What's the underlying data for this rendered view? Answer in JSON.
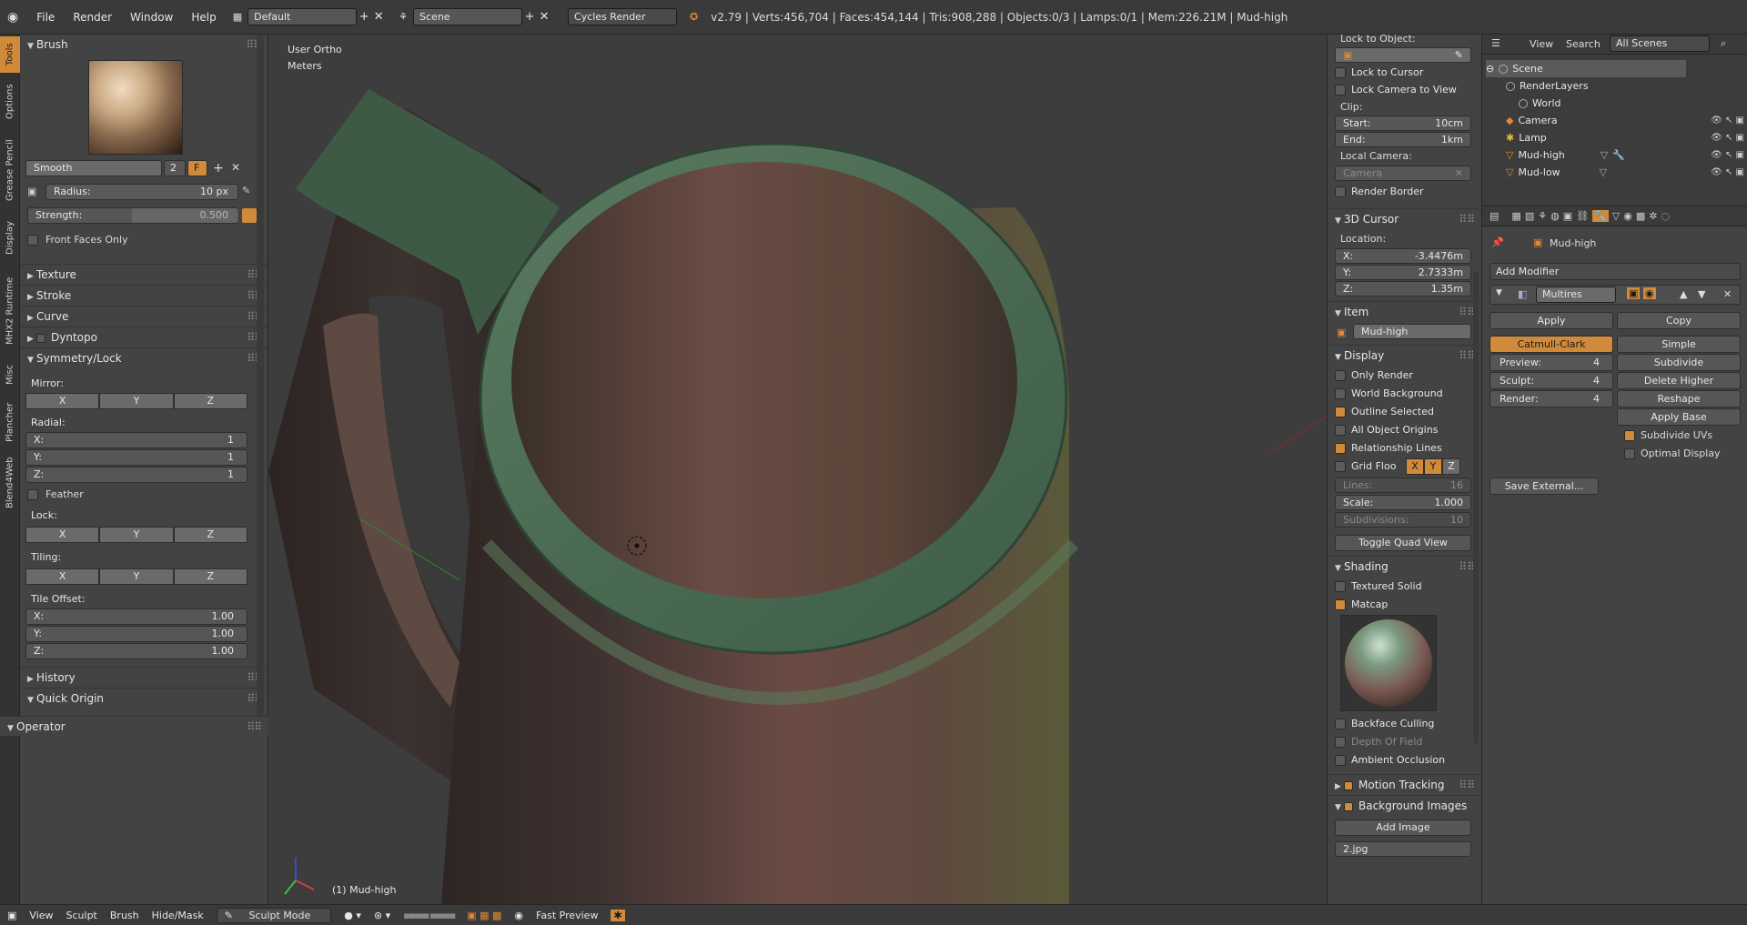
{
  "topbar": {
    "menus": [
      "File",
      "Render",
      "Window",
      "Help"
    ],
    "layout": "Default",
    "scene": "Scene",
    "engine": "Cycles Render",
    "status": "v2.79 | Verts:456,704 | Faces:454,144 | Tris:908,288 | Objects:0/3 | Lamps:0/1 | Mem:226.21M | Mud-high"
  },
  "tabs": [
    "Tools",
    "Options",
    "Grease Pencil",
    "Display",
    "MHX2 Runtime",
    "Misc",
    "Plancher",
    "Blend4Web"
  ],
  "toolshelf": {
    "brush_header": "Brush",
    "brush_name": "Smooth",
    "brush_users": "2",
    "brush_fake": "F",
    "radius_label": "Radius:",
    "radius_value": "10 px",
    "strength_label": "Strength:",
    "strength_value": "0.500",
    "front_faces": "Front Faces Only",
    "sections": [
      "Texture",
      "Stroke",
      "Curve",
      "Dyntopo"
    ],
    "symmetry_header": "Symmetry/Lock",
    "mirror": "Mirror:",
    "radial": "Radial:",
    "radial_x": "X:",
    "radial_x_val": "1",
    "radial_y": "Y:",
    "radial_y_val": "1",
    "radial_z": "Z:",
    "radial_z_val": "1",
    "feather": "Feather",
    "lock": "Lock:",
    "tiling": "Tiling:",
    "tile_offset": "Tile Offset:",
    "tile_x": "X:",
    "tile_x_val": "1.00",
    "tile_y": "Y:",
    "tile_y_val": "1.00",
    "tile_z": "Z:",
    "tile_z_val": "1.00",
    "axis_x": "X",
    "axis_y": "Y",
    "axis_z": "Z",
    "history": "History",
    "quick_origin": "Quick Origin",
    "operator": "Operator"
  },
  "viewport": {
    "view_name": "User Ortho",
    "units": "Meters",
    "object_label": "(1) Mud-high"
  },
  "npanel": {
    "lock_to_object": "Lock to Object:",
    "lock_to_cursor": "Lock to Cursor",
    "lock_camera": "Lock Camera to View",
    "clip": "Clip:",
    "start_label": "Start:",
    "start_val": "10cm",
    "end_label": "End:",
    "end_val": "1km",
    "local_camera": "Local Camera:",
    "camera_placeholder": "Camera",
    "render_border": "Render Border",
    "cursor_header": "3D Cursor",
    "location": "Location:",
    "cx_label": "X:",
    "cx_val": "-3.4476m",
    "cy_label": "Y:",
    "cy_val": "2.7333m",
    "cz_label": "Z:",
    "cz_val": "1.35m",
    "item_header": "Item",
    "item_name": "Mud-high",
    "display_header": "Display",
    "only_render": "Only Render",
    "world_bg": "World Background",
    "outline_selected": "Outline Selected",
    "all_origins": "All Object Origins",
    "relationship_lines": "Relationship Lines",
    "grid_floor": "Grid Floo",
    "gx": "X",
    "gy": "Y",
    "gz": "Z",
    "lines_label": "Lines:",
    "lines_val": "16",
    "scale_label": "Scale:",
    "scale_val": "1.000",
    "subdiv_label": "Subdivisions:",
    "subdiv_val": "10",
    "toggle_quad": "Toggle Quad View",
    "shading_header": "Shading",
    "textured_solid": "Textured Solid",
    "matcap": "Matcap",
    "backface": "Backface Culling",
    "dof": "Depth Of Field",
    "ao": "Ambient Occlusion",
    "motion_tracking": "Motion Tracking",
    "bg_images": "Background Images",
    "add_image": "Add Image",
    "img_item": "2.jpg"
  },
  "outliner": {
    "view": "View",
    "search": "Search",
    "filter": "All Scenes",
    "items": [
      "Scene",
      "RenderLayers",
      "World",
      "Camera",
      "Lamp",
      "Mud-high",
      "Mud-low"
    ]
  },
  "properties": {
    "object_name": "Mud-high",
    "add_modifier": "Add Modifier",
    "modifier_name": "Multires",
    "apply": "Apply",
    "copy": "Copy",
    "catmull": "Catmull-Clark",
    "simple": "Simple",
    "preview_label": "Preview:",
    "preview_val": "4",
    "sculpt_label": "Sculpt:",
    "sculpt_val": "4",
    "render_label": "Render:",
    "render_val": "4",
    "subdivide": "Subdivide",
    "delete_higher": "Delete Higher",
    "reshape": "Reshape",
    "apply_base": "Apply Base",
    "subdivide_uvs": "Subdivide UVs",
    "optimal_display": "Optimal Display",
    "save_external": "Save External..."
  },
  "bottombar": {
    "view": "View",
    "sculpt": "Sculpt",
    "brush": "Brush",
    "hide_mask": "Hide/Mask",
    "mode": "Sculpt Mode",
    "fast_preview": "Fast Preview"
  },
  "colors": {
    "accent": "#d08a3a",
    "mug_rim": "#4f6f55",
    "mug_body": "#5e4440"
  }
}
